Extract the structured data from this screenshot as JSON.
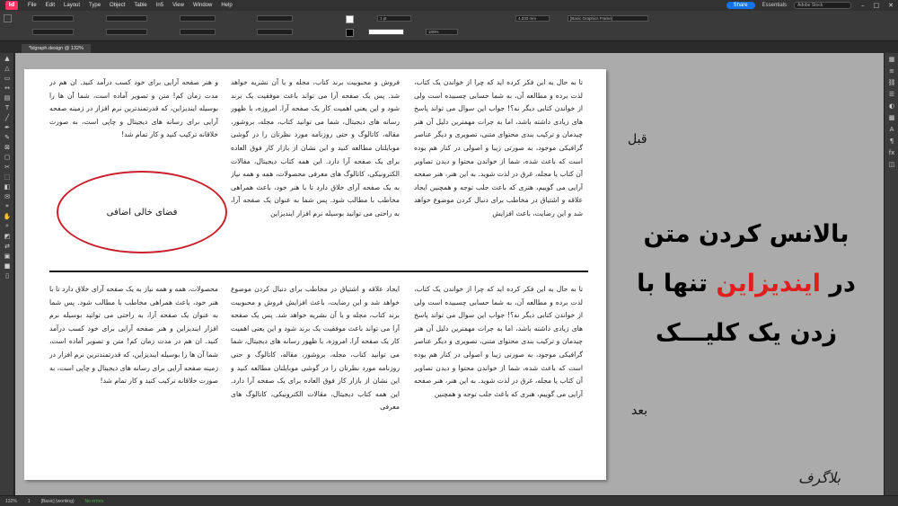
{
  "menubar": {
    "logo": "Id",
    "items": [
      "File",
      "Edit",
      "Layout",
      "Type",
      "Object",
      "Table",
      "In5",
      "View",
      "Window",
      "Help"
    ],
    "share_label": "Share",
    "workspace": "Essentials",
    "stock_placeholder": "Adobe Stock"
  },
  "controlbar": {
    "stroke_weight": "1 pt",
    "zoom": "100%",
    "width_field": "4.233 mm",
    "frame_style": "[Basic Graphics Frame]"
  },
  "tab": {
    "title": "*blgraph.design @ 132%"
  },
  "document": {
    "top_col_right": "تا به حال به این فکر کرده اید که چرا از خواندن یک کتاب، لذت برده و مطالعه آن، به شما حسابی چسبیده است ولی از خواندن کتابی دیگر نه؟! جواب این سوال می تواند پاسخ های زیادی داشته باشد، اما به جرات مهمترین دلیل آن هنر چیدمان و ترکیب بندی محتوای متنی، تصویری و دیگر عناصر گرافیکی موجود، به صورتی زیبا و اصولی در کنار هم بوده است که باعث شده، شما از خواندن محتوا و دیدن تصاویر آن کتاب یا مجله، غرق در لذت شوید. به این هنر، هنر صفحه آرایی می گوییم، هنری که باعث جلب توجه و همچنین ایجاد علاقه و اشتیاق در مخاطب برای دنبال کردن موضوع خواهد شد و این رضایت، باعث افزایش",
    "top_col_mid": "فروش و محبوبیت برند کتاب، مجله و یا آن نشریه خواهد شد. پس یک صفحه آرا می تواند باعث موفقیت یک برند شود و این یعنی اهمیت کار یک صفحه آرا. امروزه، با ظهور رسانه های دیجیتال، شما می توانید کتاب، مجله، بروشور، مقاله، کاتالوگ و حتی روزنامه مورد نظرتان را در گوشی موبایلتان مطالعه کنید و این نشان از بازار کار فوق العاده برای یک صفحه آرا دارد. این همه کتاب دیجیتال، مقالات الکترونیکی، کاتالوگ های معرفی محصولات، همه و همه نیاز به یک صفحه آرای خلاق دارد تا با هنر خود، باعث همراهی مخاطب با مطالب شود. پس شما به عنوان یک صفحه آرا، به راحتی می توانید بوسیله نرم افزار ایندیزاین",
    "top_col_left": "و هنر صفحه آرایی برای خود کسب درآمد کنید. ان هم در مدت زمان کم! متن و تصویر آماده است، شما آن ها را بوسیله ایندیزاین، که قدرتمندترین نرم افزار در زمینه صفحه آرایی برای رسانه های دیجیتال و چاپی است، به صورت خلاقانه ترکیب کنید و کار تمام شد!",
    "ellipse_label": "فضای خالی اضافی",
    "bottom_col_right": "تا به حال به این فکر کرده اید که چرا از خواندن یک کتاب، لذت برده و مطالعه آن، به شما حسابی چسبیده است ولی از خواندن کتابی دیگر نه؟! جواب این سوال می تواند پاسخ های زیادی داشته باشد، اما به جرات مهمترین دلیل آن هنر چیدمان و ترکیب بندی محتوای متنی، تصویری و دیگر عناصر گرافیکی موجود، به صورتی زیبا و اصولی در کنار هم بوده است که باعث شده، شما از خواندن محتوا و دیدن تصاویر آن کتاب یا مجله، غرق در لذت شوید. به این هنر، هنر صفحه آرایی می گوییم، هنری که باعث جلب توجه و همچنین",
    "bottom_col_mid": "ایجاد علاقه و اشتیاق در مخاطب برای دنبال کردن موضوع خواهد شد و این رضایت، باعث افزایش فروش و محبوبیت برند کتاب، مجله و یا آن نشریه خواهد شد. پس یک صفحه آرا می تواند باعث موفقیت یک برند شود و این یعنی اهمیت کار یک صفحه آرا. امروزه، با ظهور رسانه های دیجیتال، شما می توانید کتاب، مجله، بروشور، مقاله، کاتالوگ و حتی روزنامه مورد نظرتان را در گوشی موبایلتان مطالعه کنید و این نشان از بازار کار فوق العاده برای یک صفحه آرا دارد. این همه کتاب دیجیتال، مقالات الکترونیکی، کاتالوگ های معرفی",
    "bottom_col_left": "محصولات، همه و همه نیاز به یک صفحه آرای خلاق دارد تا با هنر خود، باعث همراهی مخاطب با مطالب شود. پس شما به عنوان یک صفحه آرا، به راحتی می توانید بوسیله نرم افزار ایندیزاین و هنر صفحه آرایی برای خود کسب درآمد کنید. ان هم در مدت زمان کم! متن و تصویر آماده است، شما آن ها را بوسیله ایندیزاین، که قدرتمندترین نرم افزار در زمینه صفحه آرایی برای رسانه های دیجیتال و چاپی است، به صورت خلاقانه ترکیب کنید و کار تمام شد!"
  },
  "annotations": {
    "before": "قبل",
    "after": "بعد",
    "headline_line1": "بالانس کردن متن",
    "headline_line2_pre": "در ",
    "headline_line2_highlight": "ایندیزاین",
    "headline_line2_post": " تنها با",
    "headline_line3": "زدن یک کلیـــک",
    "brand": "بلاگرف"
  },
  "statusbar": {
    "zoom": "132%",
    "page": "1",
    "style": "[Basic] (working)",
    "errors": "No errors"
  },
  "colors": {
    "accent_red": "#e01e1e",
    "ellipse_red": "#c8202c",
    "share_blue": "#1473e6"
  }
}
